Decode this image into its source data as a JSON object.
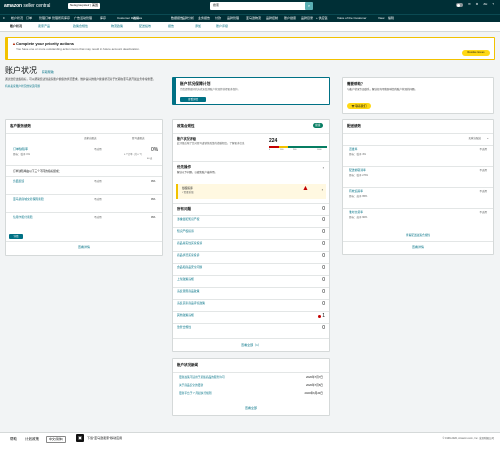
{
  "header": {
    "logo": "amazon",
    "logo_sub": "seller central",
    "store": "Netsgroupsteir | 美国",
    "search_placeholder": "搜索",
    "language": "ZH"
  },
  "nav": [
    "目录",
    "库存",
    "定价",
    "订单",
    "广告",
    "品牌旗舰店",
    "促销",
    "发展",
    "数据报告",
    "业务健康",
    "应用商店",
    "亚马逊物流"
  ],
  "nav_extra": [
    "≡",
    "帐户状况",
    "订单",
    "管理订单",
    "管理所有库存",
    "广告活动管理",
    "库存",
    "Customer Reviews",
    "发货",
    "数据报告",
    "品牌分析",
    "业务报告",
    "付款",
    "品牌管理",
    "亚马逊物流",
    "品牌控制",
    "账户健康",
    "品牌目录",
    "+ 供应链",
    "Voice of the Customer",
    "View",
    "编辑"
  ],
  "subnav": [
    "账户状况",
    "卖家产品",
    "政策合规性",
    "物流政策",
    "配送绩效",
    "报告",
    "添加",
    "账户评级"
  ],
  "alert": {
    "title": "Complete your priority actions",
    "desc": "You have one or more outstanding action items that may result in future account deactivation.",
    "button": "Resolve Issues"
  },
  "page": {
    "title": "账户状况",
    "help_link": "获取帮助",
    "intro": "通过监控这些指标，可以帮助您达到卖家账户健康的状况要求。维护良好的账户健康状况对于长期在亚马逊开展业务非常重要。",
    "faq_link": "有关卖家账户状况的常见问题"
  },
  "health_plan": {
    "title": "账户状况保障计划",
    "desc": "为您提供更好的方式来监测账户状况并获得更多保护。",
    "link": "查看详情"
  },
  "help_card": {
    "title": "需要帮助？",
    "desc": "与账户状况专员联系，解决任何可能影响您的账户状况的问题。",
    "button": "联系我们"
  },
  "customer_service": {
    "title": "客户服务绩效",
    "col1": "卖家自配送",
    "col2": "亚马逊配送",
    "metric": "订单缺陷率",
    "metric_target": "目标：低于 1%",
    "v1": "不适用",
    "v2": "0%",
    "v2_sub": "0 个订单（共 0 个）",
    "v2_sub2": "60 天",
    "sub_title": "订单缺陷率由以下三个不同的指标组成：",
    "items": [
      {
        "label": "负面反馈",
        "v1": "不适用",
        "v2": "0%"
      },
      {
        "label": "亚马逊商城交易保障索赔",
        "v1": "不适用",
        "v2": "0%"
      },
      {
        "label": "信用卡拒付索赔",
        "v1": "不适用",
        "v2": "0%"
      }
    ],
    "footer_btn": "详情",
    "view_link": "查看详情"
  },
  "policy": {
    "title": "政策合规性",
    "badge": "健康",
    "ahr_title": "账户状况评级",
    "ahr_desc": "此评级反映了您对亚马逊销售政策的遵循程度。了解更多信息",
    "ahr_value": "224",
    "scale": [
      "0",
      "100",
      "200",
      "1000"
    ],
    "priority_title": "优先操作",
    "priority_desc": "解决以下问题，以避免账户被停用。",
    "priority_item": "侵权投诉",
    "priority_item_sub": "• 需要采取",
    "issues_title": "所有问题",
    "issues_count": "0",
    "issues": [
      {
        "label": "涉嫌侵犯知识产权",
        "value": "0"
      },
      {
        "label": "知识产权投诉",
        "value": "0"
      },
      {
        "label": "商品真实性买家投诉",
        "value": "0"
      },
      {
        "label": "商品状况买家投诉",
        "value": "0"
      },
      {
        "label": "食品和商品安全问题",
        "value": "0"
      },
      {
        "label": "上架政策违规",
        "value": "0"
      },
      {
        "label": "违反受限商品政策",
        "value": "0"
      },
      {
        "label": "违反买家商品评论政策",
        "value": "0"
      },
      {
        "label": "其他政策违规",
        "value": "1"
      },
      {
        "label": "监管合规性",
        "value": "0"
      }
    ],
    "view_link": "查看全部（1）"
  },
  "news": {
    "title": "账户状况新闻",
    "items": [
      {
        "label": "更新政策不适用于某些商品的服务许可",
        "date": "2020年7月7日"
      },
      {
        "label": "关于商品安全的更新",
        "date": "2020年7月6日"
      },
      {
        "label": "更新平台于 7 月起执行规则",
        "date": "2020年6月20日"
      }
    ],
    "view_link": "查看全部"
  },
  "shipping": {
    "title": "配送绩效",
    "col1": "卖家自配送",
    "items": [
      {
        "label": "迟发率",
        "target": "目标：低于 4%",
        "value": "不适用"
      },
      {
        "label": "配送前取消率",
        "target": "目标：低于 2.5%",
        "value": "不适用"
      },
      {
        "label": "有效追踪率",
        "target": "目标：高于 95%",
        "value": "不适用"
      },
      {
        "label": "准时交货率",
        "target": "目标：高于 90%",
        "value": "不适用"
      }
    ],
    "link": "查看配送政策合规性",
    "view_link": "查看详情"
  },
  "footer": {
    "help": "帮助",
    "guide": "计划政策",
    "lang": "中文(简体)",
    "app": "下载\"亚马逊卖家\"移动应用",
    "copyright": "© 1999-2020, Amazon.com, Inc. 或其附属公司"
  },
  "colors": {
    "brand_dark": "#002f36",
    "accent": "#007185",
    "button": "#ffd814",
    "good": "#067d62",
    "warn": "#f2c200",
    "danger": "#c40000"
  }
}
